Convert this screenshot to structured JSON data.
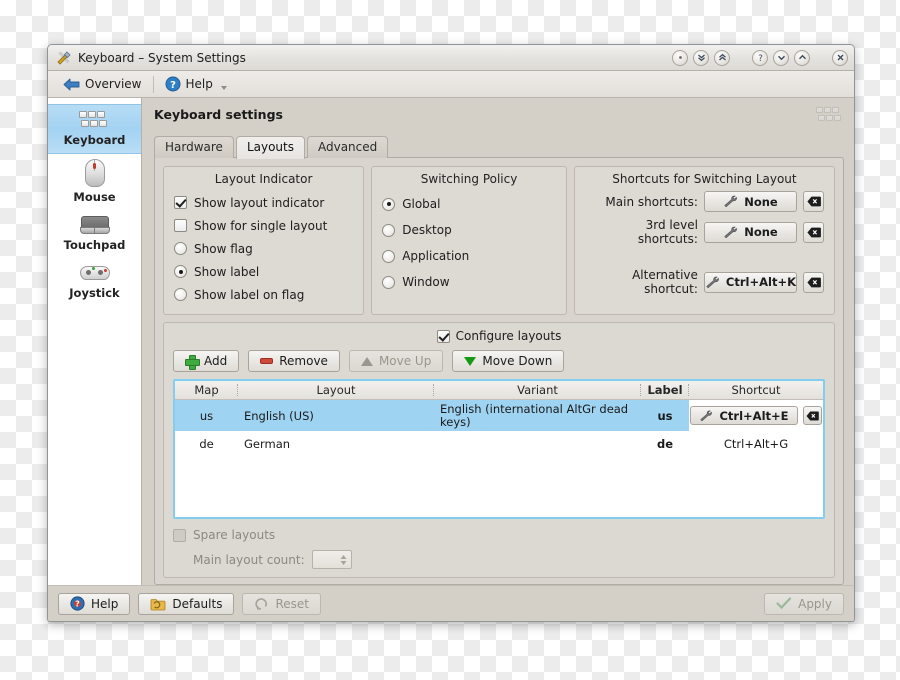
{
  "window": {
    "title": "Keyboard – System Settings",
    "title_icon": "tools-icon",
    "buttons": [
      {
        "name": "shade-button",
        "glyph": "·"
      },
      {
        "name": "keep-below-button",
        "glyph": "chevrons-down"
      },
      {
        "name": "keep-above-button",
        "glyph": "chevrons-up"
      },
      {
        "name": "help-button",
        "glyph": "?"
      },
      {
        "name": "minimize-button",
        "glyph": "chevron-down"
      },
      {
        "name": "maximize-button",
        "glyph": "chevron-up"
      },
      {
        "name": "close-button",
        "glyph": "×"
      }
    ]
  },
  "toolbar": {
    "overview_label": "Overview",
    "overview_icon": "back-arrow-icon",
    "help_label": "Help",
    "help_icon": "help-circle-icon",
    "help_dropdown_icon": "chevron-down-icon"
  },
  "sidebar": {
    "items": [
      {
        "label": "Keyboard",
        "icon": "keyboard-icon",
        "selected": true
      },
      {
        "label": "Mouse",
        "icon": "mouse-icon",
        "selected": false
      },
      {
        "label": "Touchpad",
        "icon": "touchpad-icon",
        "selected": false
      },
      {
        "label": "Joystick",
        "icon": "joystick-icon",
        "selected": false
      }
    ]
  },
  "content": {
    "title": "Keyboard settings",
    "header_icon": "keyboard-icon",
    "tabs": [
      {
        "label": "Hardware",
        "active": false
      },
      {
        "label": "Layouts",
        "active": true
      },
      {
        "label": "Advanced",
        "active": false
      }
    ]
  },
  "layout_indicator": {
    "title": "Layout Indicator",
    "options": [
      {
        "label": "Show layout indicator",
        "type": "checkbox",
        "checked": true,
        "enabled": true
      },
      {
        "label": "Show for single layout",
        "type": "checkbox",
        "checked": false,
        "enabled": true
      },
      {
        "label": "Show flag",
        "type": "radio",
        "checked": false,
        "enabled": true
      },
      {
        "label": "Show label",
        "type": "radio",
        "checked": true,
        "enabled": true
      },
      {
        "label": "Show label on flag",
        "type": "radio",
        "checked": false,
        "enabled": true
      }
    ]
  },
  "switching_policy": {
    "title": "Switching Policy",
    "options": [
      {
        "label": "Global",
        "checked": true
      },
      {
        "label": "Desktop",
        "checked": false
      },
      {
        "label": "Application",
        "checked": false
      },
      {
        "label": "Window",
        "checked": false
      }
    ]
  },
  "shortcuts": {
    "title": "Shortcuts for Switching Layout",
    "rows": [
      {
        "label": "Main shortcuts:",
        "value": "None",
        "icon": "wrench-icon",
        "clear_icon": "clear-icon"
      },
      {
        "label": "3rd level shortcuts:",
        "value": "None",
        "icon": "wrench-icon",
        "clear_icon": "clear-icon"
      },
      {
        "label": "Alternative shortcut:",
        "value": "Ctrl+Alt+K",
        "icon": "wrench-icon",
        "clear_icon": "clear-icon"
      }
    ]
  },
  "configure": {
    "checkbox_label": "Configure layouts",
    "checkbox_checked": true,
    "buttons": [
      {
        "label": "Add",
        "icon": "plus-icon",
        "enabled": true
      },
      {
        "label": "Remove",
        "icon": "minus-icon",
        "enabled": true
      },
      {
        "label": "Move Up",
        "icon": "triangle-up-icon",
        "enabled": false
      },
      {
        "label": "Move Down",
        "icon": "triangle-down-icon",
        "enabled": true
      }
    ],
    "spare_layouts_label": "Spare layouts",
    "spare_layouts_checked": false,
    "spare_layouts_enabled": false,
    "main_layout_count_label": "Main layout count:",
    "main_layout_count_value": "",
    "main_layout_count_enabled": false
  },
  "table": {
    "columns": [
      "Map",
      "Layout",
      "Variant",
      "Label",
      "Shortcut"
    ],
    "rows": [
      {
        "map": "us",
        "layout": "English (US)",
        "variant": "English (international AltGr dead keys)",
        "label": "us",
        "shortcut": "Ctrl+Alt+E",
        "selected": true,
        "shortcut_icon": "wrench-icon",
        "shortcut_clear_icon": "clear-icon"
      },
      {
        "map": "de",
        "layout": "German",
        "variant": "",
        "label": "de",
        "shortcut": "Ctrl+Alt+G",
        "selected": false
      }
    ]
  },
  "bottom_bar": {
    "buttons": [
      {
        "label": "Help",
        "icon": "help-badge-icon",
        "enabled": true
      },
      {
        "label": "Defaults",
        "icon": "defaults-icon",
        "enabled": true
      },
      {
        "label": "Reset",
        "icon": "reset-icon",
        "enabled": false
      },
      {
        "label": "Apply",
        "icon": "apply-check-icon",
        "enabled": false
      }
    ]
  },
  "colors": {
    "selection_blue": "#9fd3f2",
    "sidebar_selected": "#a3d2f2",
    "table_focus_border": "#82cdf0",
    "window_bg": "#d4d0c8",
    "accent_green": "#169a16",
    "accent_red": "#d04a3c"
  }
}
